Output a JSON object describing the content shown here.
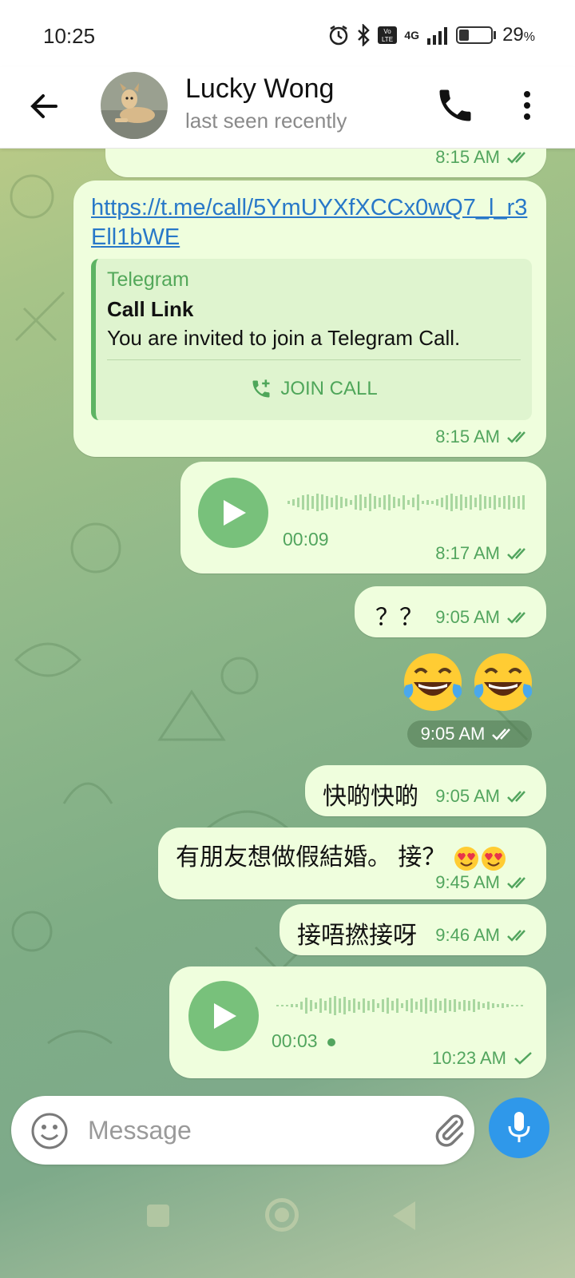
{
  "status_bar": {
    "time": "10:25",
    "network": "4G",
    "battery_percent": "29",
    "battery_symbol": "%"
  },
  "header": {
    "contact_name": "Lucky Wong",
    "contact_status": "last seen recently"
  },
  "messages": {
    "m0_time": "8:15 AM",
    "link": {
      "url": "https://t.me/call/5YmUYXfXCCx0wQ7_l_r3Ell1bWE",
      "site": "Telegram",
      "title": "Call Link",
      "description": "You are invited to join a Telegram Call.",
      "button": "JOIN CALL",
      "time": "8:15 AM"
    },
    "voice1": {
      "duration": "00:09",
      "time": "8:17 AM"
    },
    "m_qq": {
      "text": "？？",
      "time": "9:05 AM"
    },
    "emoji": {
      "time": "9:05 AM"
    },
    "m_fast": {
      "text": "快啲快啲",
      "time": "9:05 AM"
    },
    "m_friend": {
      "text": "有朋友想做假結婚。 接？",
      "time": "9:45 AM"
    },
    "m_take": {
      "text": "接唔撚接呀",
      "time": "9:46 AM"
    },
    "voice2": {
      "duration": "00:03",
      "time": "10:23 AM"
    }
  },
  "composer": {
    "placeholder": "Message"
  },
  "icons": {
    "back": "arrow-left-icon",
    "call": "phone-icon",
    "menu": "more-vertical-icon",
    "play": "play-icon",
    "emoji": "smiley-icon",
    "attach": "paperclip-icon",
    "mic": "microphone-icon"
  },
  "colors": {
    "bubble": "#effedd",
    "accent_green": "#52a55e",
    "link_blue": "#2878c8",
    "mic_blue": "#2f98ea"
  }
}
